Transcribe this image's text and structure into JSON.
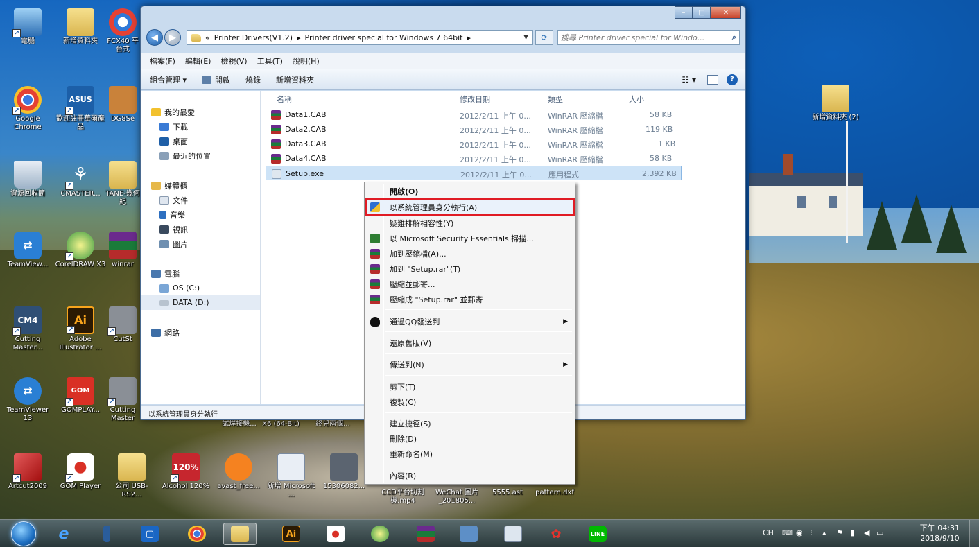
{
  "desktop": {
    "icons": [
      {
        "label": "電腦"
      },
      {
        "label": "新增資料夾"
      },
      {
        "label": "FCX40 平台式"
      },
      {
        "label": "Google Chrome"
      },
      {
        "label": "歡迎註冊華碩產品"
      },
      {
        "label": "DG8Se"
      },
      {
        "label": "資源回收筒"
      },
      {
        "label": "CMASTER..."
      },
      {
        "label": "TANE-幾何紀"
      },
      {
        "label": "TeamView..."
      },
      {
        "label": "CorelDRAW X3"
      },
      {
        "label": "winrar"
      },
      {
        "label": "Cutting Master..."
      },
      {
        "label": "Adobe Illustrator ..."
      },
      {
        "label": "CutSt"
      },
      {
        "label": "TeamViewer 13"
      },
      {
        "label": "GOMPLAY..."
      },
      {
        "label": "Cutting Master"
      },
      {
        "label": "試焊接機..."
      },
      {
        "label": "X6 (64-Bit)"
      },
      {
        "label": "終兒兩個..."
      },
      {
        "label": "Artcut2009"
      },
      {
        "label": "GOM Player"
      },
      {
        "label": "公司 USB-RS2..."
      },
      {
        "label": "Alcohol 120%"
      },
      {
        "label": "avast_free..."
      },
      {
        "label": "新增 Microsoft ..."
      },
      {
        "label": "15306082..."
      },
      {
        "label": "CCD平台切割機.mp4"
      },
      {
        "label": "WeChat 圖片_201805..."
      },
      {
        "label": "5555.ast"
      },
      {
        "label": "pattern.dxf"
      },
      {
        "label": "新增資料夾 (2)"
      }
    ]
  },
  "window": {
    "address": {
      "crumb1": "Printer Drivers(V1.2)",
      "crumb2": "Printer driver special for Windows 7 64bit",
      "prefix": "«"
    },
    "search_placeholder": "搜尋 Printer driver special for Windo...",
    "menu": [
      "檔案(F)",
      "編輯(E)",
      "檢視(V)",
      "工具(T)",
      "說明(H)"
    ],
    "toolbar": {
      "organize": "組合管理 ▾",
      "open": "開啟",
      "burn": "燒錄",
      "new_folder": "新增資料夾"
    },
    "nav": {
      "favorites": "我的最愛",
      "downloads": "下載",
      "desktop": "桌面",
      "recent": "最近的位置",
      "libraries": "媒體櫃",
      "documents": "文件",
      "music": "音樂",
      "videos": "視訊",
      "pictures": "圖片",
      "computer": "電腦",
      "os_c": "OS (C:)",
      "data_d": "DATA (D:)",
      "network": "網路"
    },
    "columns": {
      "name": "名稱",
      "date": "修改日期",
      "type": "類型",
      "size": "大小"
    },
    "files": [
      {
        "name": "Data1.CAB",
        "date": "2012/2/11 上午 0...",
        "type": "WinRAR 壓縮檔",
        "size": "58 KB"
      },
      {
        "name": "Data2.CAB",
        "date": "2012/2/11 上午 0...",
        "type": "WinRAR 壓縮檔",
        "size": "119 KB"
      },
      {
        "name": "Data3.CAB",
        "date": "2012/2/11 上午 0...",
        "type": "WinRAR 壓縮檔",
        "size": "1 KB"
      },
      {
        "name": "Data4.CAB",
        "date": "2012/2/11 上午 0...",
        "type": "WinRAR 壓縮檔",
        "size": "58 KB"
      },
      {
        "name": "Setup.exe",
        "date": "2012/2/11 上午 0...",
        "type": "應用程式",
        "size": "2,392 KB"
      }
    ],
    "status": "以系統管理員身分執行"
  },
  "context_menu": {
    "open": "開啟(O)",
    "run_as_admin": "以系統管理員身分執行(A)",
    "troubleshoot": "疑難排解相容性(Y)",
    "scan_mse": "以 Microsoft Security Essentials 掃描...",
    "add_archive": "加到壓縮檔(A)...",
    "add_setup_rar": "加到 \"Setup.rar\"(T)",
    "compress_email": "壓縮並郵寄...",
    "compress_setup_email": "壓縮成 \"Setup.rar\" 並郵寄",
    "send_qq": "通過QQ發送到",
    "restore": "還原舊版(V)",
    "send_to": "傳送到(N)",
    "cut": "剪下(T)",
    "copy": "複製(C)",
    "shortcut": "建立捷徑(S)",
    "delete": "刪除(D)",
    "rename": "重新命名(M)",
    "properties": "內容(R)"
  },
  "tray": {
    "ime": "CH",
    "time": "下午 04:31",
    "date": "2018/9/10"
  }
}
